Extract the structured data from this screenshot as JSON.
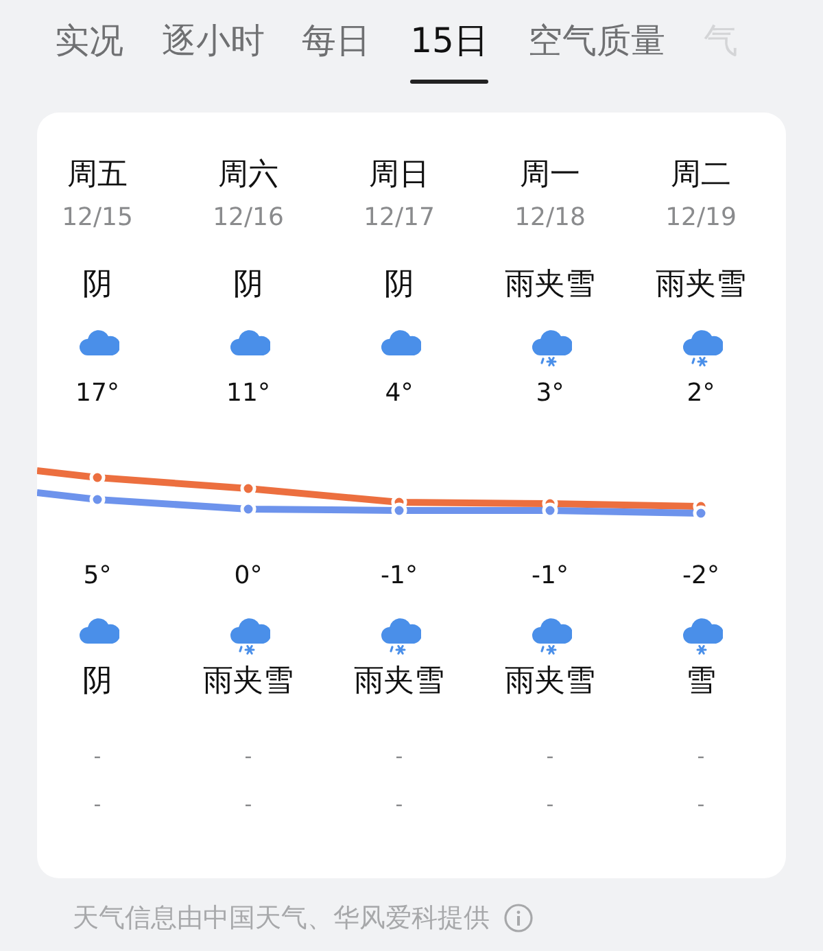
{
  "tabs": [
    {
      "label": "实况",
      "selected": false
    },
    {
      "label": "逐小时",
      "selected": false
    },
    {
      "label": "每日",
      "selected": false
    },
    {
      "label": "15日",
      "selected": true
    },
    {
      "label": "空气质量",
      "selected": false
    },
    {
      "label": "气",
      "selected": false,
      "faded": true
    }
  ],
  "days": [
    {
      "weekday": "周五",
      "date": "12/15",
      "day_condition": "阴",
      "day_icon": {
        "kind": "cloudy"
      },
      "high": "17°",
      "low": "5°",
      "night_icon": {
        "kind": "cloudy"
      },
      "night_condition": "阴",
      "row_1": "-",
      "row_2": "-"
    },
    {
      "weekday": "周六",
      "date": "12/16",
      "day_condition": "阴",
      "day_icon": {
        "kind": "cloudy"
      },
      "high": "11°",
      "low": "0°",
      "night_icon": {
        "kind": "sleet"
      },
      "night_condition": "雨夹雪",
      "row_1": "-",
      "row_2": "-"
    },
    {
      "weekday": "周日",
      "date": "12/17",
      "day_condition": "阴",
      "day_icon": {
        "kind": "cloudy"
      },
      "high": "4°",
      "low": "-1°",
      "night_icon": {
        "kind": "sleet"
      },
      "night_condition": "雨夹雪",
      "row_1": "-",
      "row_2": "-"
    },
    {
      "weekday": "周一",
      "date": "12/18",
      "day_condition": "雨夹雪",
      "day_icon": {
        "kind": "sleet"
      },
      "high": "3°",
      "low": "-1°",
      "night_icon": {
        "kind": "sleet"
      },
      "night_condition": "雨夹雪",
      "row_1": "-",
      "row_2": "-"
    },
    {
      "weekday": "周二",
      "date": "12/19",
      "day_condition": "雨夹雪",
      "day_icon": {
        "kind": "sleet"
      },
      "high": "2°",
      "low": "-2°",
      "night_icon": {
        "kind": "snow"
      },
      "night_condition": "雪",
      "row_1": "-",
      "row_2": "-"
    }
  ],
  "footer": "天气信息由中国天气、华风爱科提供"
}
